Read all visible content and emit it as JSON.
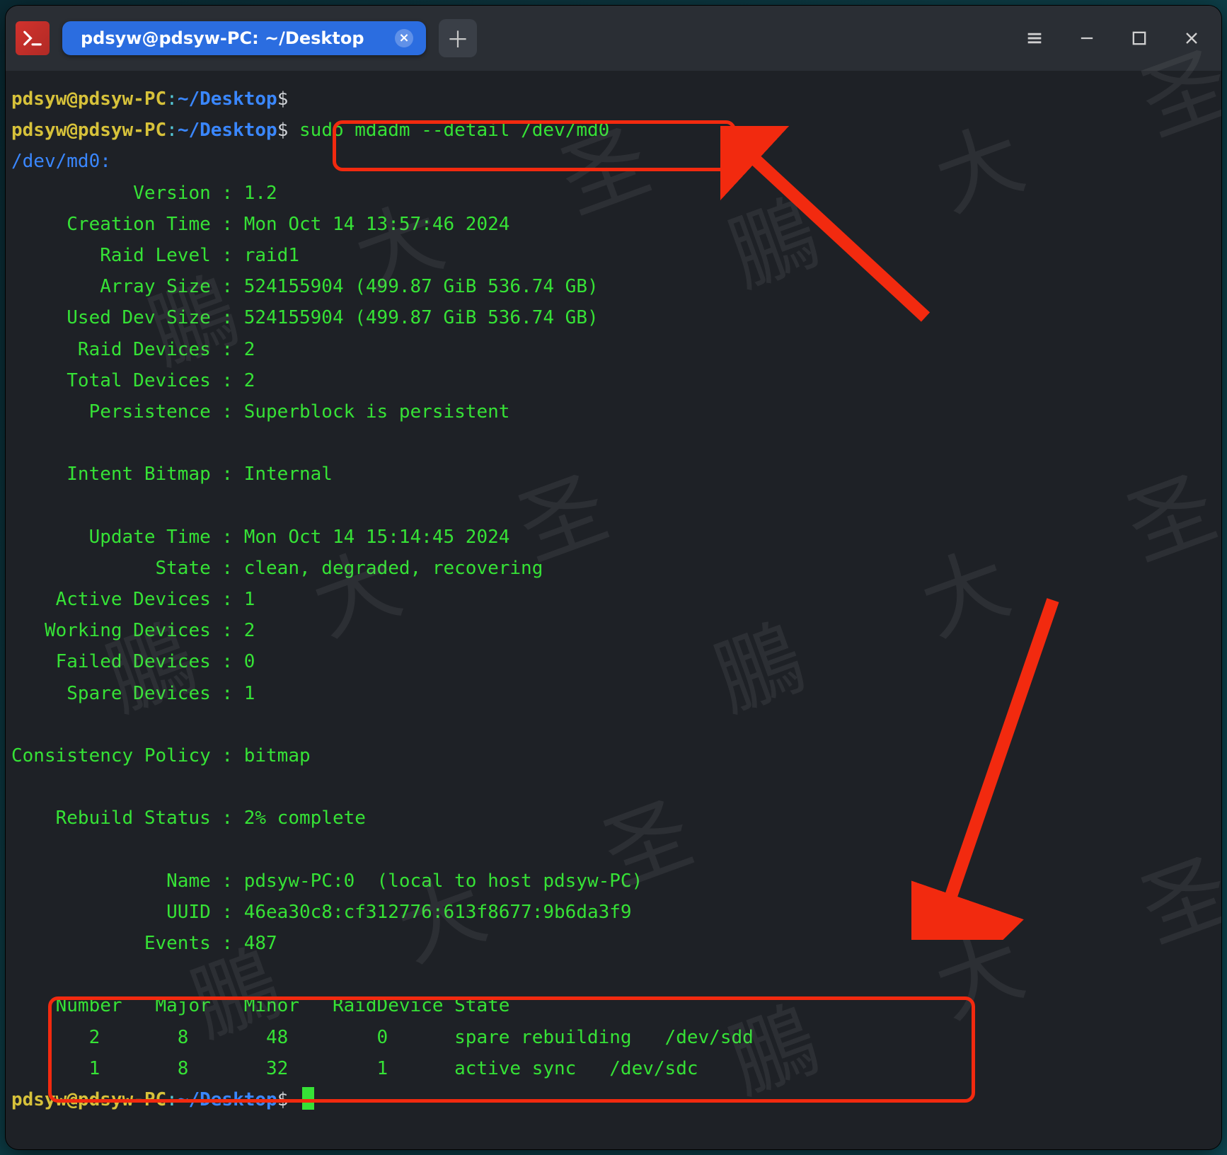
{
  "titlebar": {
    "tab_title": "pdsyw@pdsyw-PC: ~/Desktop"
  },
  "prompt": {
    "user": "pdsyw@pdsyw-PC",
    "sep": ":",
    "path": "~/Desktop",
    "symbol": "$"
  },
  "command": "sudo mdadm --detail /dev/md0",
  "device_header": "/dev/md0:",
  "fields": [
    {
      "label": "Version",
      "value": "1.2"
    },
    {
      "label": "Creation Time",
      "value": "Mon Oct 14 13:57:46 2024"
    },
    {
      "label": "Raid Level",
      "value": "raid1"
    },
    {
      "label": "Array Size",
      "value": "524155904 (499.87 GiB 536.74 GB)"
    },
    {
      "label": "Used Dev Size",
      "value": "524155904 (499.87 GiB 536.74 GB)"
    },
    {
      "label": "Raid Devices",
      "value": "2"
    },
    {
      "label": "Total Devices",
      "value": "2"
    },
    {
      "label": "Persistence",
      "value": "Superblock is persistent"
    },
    {
      "label": "",
      "value": ""
    },
    {
      "label": "Intent Bitmap",
      "value": "Internal"
    },
    {
      "label": "",
      "value": ""
    },
    {
      "label": "Update Time",
      "value": "Mon Oct 14 15:14:45 2024"
    },
    {
      "label": "State",
      "value": "clean, degraded, recovering"
    },
    {
      "label": "Active Devices",
      "value": "1"
    },
    {
      "label": "Working Devices",
      "value": "2"
    },
    {
      "label": "Failed Devices",
      "value": "0"
    },
    {
      "label": "Spare Devices",
      "value": "1"
    },
    {
      "label": "",
      "value": ""
    },
    {
      "label": "Consistency Policy",
      "value": "bitmap"
    },
    {
      "label": "",
      "value": ""
    },
    {
      "label": "Rebuild Status",
      "value": "2% complete"
    },
    {
      "label": "",
      "value": ""
    },
    {
      "label": "Name",
      "value": "pdsyw-PC:0  (local to host pdsyw-PC)"
    },
    {
      "label": "UUID",
      "value": "46ea30c8:cf312776:613f8677:9b6da3f9"
    },
    {
      "label": "Events",
      "value": "487"
    }
  ],
  "table": {
    "header": "    Number   Major   Minor   RaidDevice State",
    "rows": [
      "       2       8       48        0      spare rebuilding   /dev/sdd",
      "       1       8       32        1      active sync   /dev/sdc"
    ]
  },
  "watermark": "鵬 大 圣"
}
